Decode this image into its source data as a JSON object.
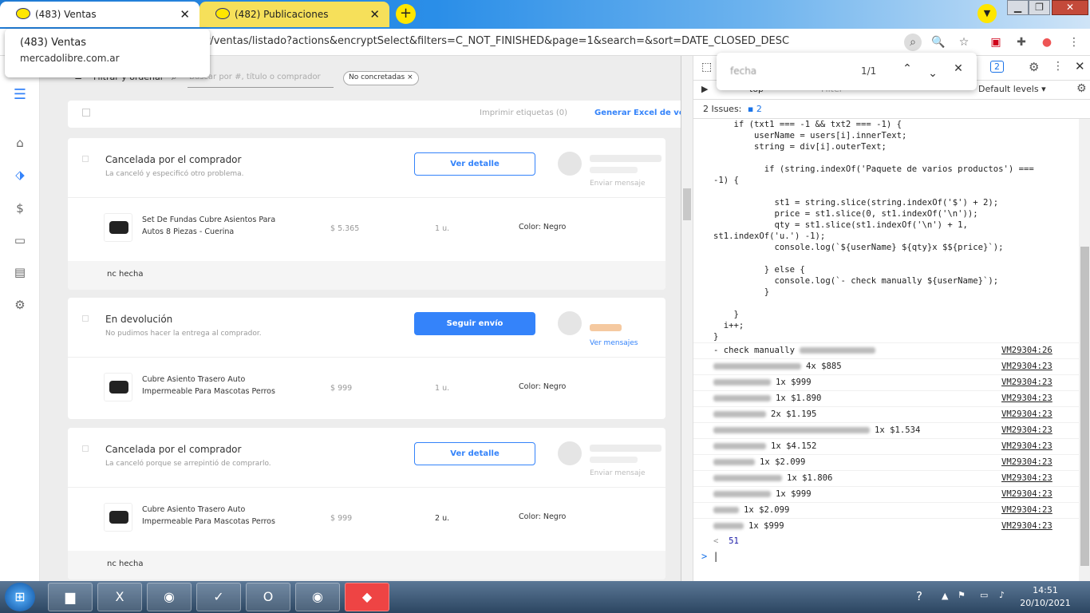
{
  "browser": {
    "tabs": [
      {
        "label": "(483) Ventas"
      },
      {
        "label": "(482) Publicaciones"
      }
    ],
    "new_tab": "+",
    "url": "r/ventas/listado?actions&encryptSelect&filters=C_NOT_FINISHED&page=1&search=&sort=DATE_CLOSED_DESC",
    "hover_card": {
      "title": "(483) Ventas",
      "domain": "mercadolibre.com.ar"
    },
    "window_buttons": {
      "minimize": "▁",
      "maximize": "❐",
      "close": "✕"
    }
  },
  "page": {
    "filter_label": "Filtrar y ordenar",
    "search_placeholder": "Buscar por #, título o comprador",
    "chip": "No concretadas",
    "chip_close": "×",
    "print_labels": "Imprimir etiquetas (0)",
    "excel": "Generar Excel de ven",
    "orders": [
      {
        "status": "Cancelada por el comprador",
        "desc": "La canceló y especificó otro problema.",
        "button": "Ver detalle",
        "message": "Enviar mensaje",
        "product": "Set De Fundas Cubre Asientos Para Autos 8 Piezas - Cuerina",
        "price": "$ 5.365",
        "qty": "1 u.",
        "color": "Color: Negro",
        "note": "nc hecha"
      },
      {
        "status": "En devolución",
        "desc": "No pudimos hacer la entrega al comprador.",
        "button": "Seguir envío",
        "message": "Ver mensajes",
        "product": "Cubre Asiento Trasero Auto Impermeable Para Mascotas Perros",
        "price": "$ 999",
        "qty": "1 u.",
        "color": "Color: Negro"
      },
      {
        "status": "Cancelada por el comprador",
        "desc": "La canceló porque se arrepintió de comprarlo.",
        "button": "Ver detalle",
        "message": "Enviar mensaje",
        "product": "Cubre Asiento Trasero Auto Impermeable Para Mascotas Perros",
        "price": "$ 999",
        "qty": "2 u.",
        "color": "Color: Negro",
        "note": "nc hecha"
      }
    ]
  },
  "devtools": {
    "issues_badge": "2",
    "filter_placeholder": "Filter",
    "levels": "Default levels ▾",
    "issues_label": "2 Issues:",
    "issues_count": "2",
    "top_label": "top",
    "find": {
      "query": "fecha",
      "count": "1/1"
    },
    "code": [
      "    if (txt1 === -1 && txt2 === -1) {",
      "        userName = users[i].innerText;",
      "        string = div[i].outerText;",
      "",
      "          if (string.indexOf('Paquete de varios productos') ===",
      "-1) {",
      "",
      "            st1 = string.slice(string.indexOf('$') + 2);",
      "            price = st1.slice(0, st1.indexOf('\\n'));",
      "            qty = st1.slice(st1.indexOf('\\n') + 1,",
      "st1.indexOf('u.') -1);",
      "            console.log(`${userName} ${qty}x $${price}`);",
      "",
      "          } else {",
      "            console.log(`- check manually ${userName}`);",
      "          }",
      "",
      "    }",
      "  i++;",
      "}"
    ],
    "logs": [
      {
        "text": "- check manually",
        "blur": 95,
        "src": "VM29304:26",
        "after": ""
      },
      {
        "text": "",
        "blur": 110,
        "src": "VM29304:23",
        "after": "4x $885"
      },
      {
        "text": "",
        "blur": 72,
        "src": "VM29304:23",
        "after": "1x $999"
      },
      {
        "text": "",
        "blur": 72,
        "src": "VM29304:23",
        "after": "1x $1.890"
      },
      {
        "text": "",
        "blur": 66,
        "src": "VM29304:23",
        "after": "2x $1.195"
      },
      {
        "text": "",
        "blur": 196,
        "src": "VM29304:23",
        "after": "1x $1.534"
      },
      {
        "text": "",
        "blur": 66,
        "src": "VM29304:23",
        "after": "1x $4.152"
      },
      {
        "text": "",
        "blur": 52,
        "src": "VM29304:23",
        "after": "1x $2.099"
      },
      {
        "text": "",
        "blur": 86,
        "src": "VM29304:23",
        "after": "1x $1.806"
      },
      {
        "text": "",
        "blur": 72,
        "src": "VM29304:23",
        "after": "1x $999"
      },
      {
        "text": "",
        "blur": 32,
        "src": "VM29304:23",
        "after": "1x $2.099"
      },
      {
        "text": "",
        "blur": 38,
        "src": "VM29304:23",
        "after": "1x $999"
      }
    ],
    "result": "51",
    "result_arrow": "<",
    "prompt": ">"
  },
  "taskbar": {
    "time": "14:51",
    "date": "20/10/2021"
  },
  "colors": {
    "accent": "#3483fa",
    "ml_yellow": "#ffe600"
  }
}
